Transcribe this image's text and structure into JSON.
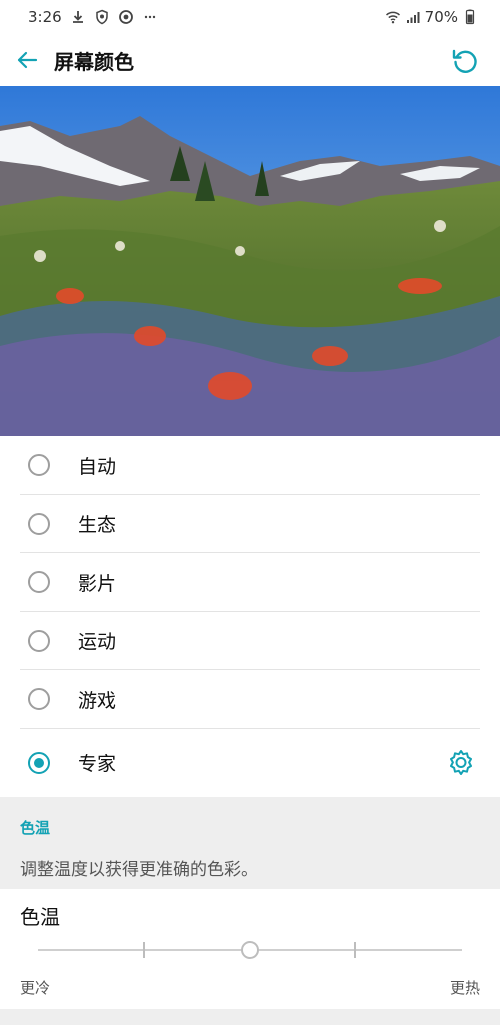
{
  "status_bar": {
    "time": "3:26",
    "battery": "70%",
    "icons": [
      "download-icon",
      "shield-badge-icon",
      "sync-icon",
      "more-dots-icon",
      "wifi-icon",
      "signal-icon",
      "battery-icon"
    ]
  },
  "app_bar": {
    "title": "屏幕颜色",
    "back_icon": "back-arrow-icon",
    "reset_icon": "reset-icon"
  },
  "preview": {
    "description_icon": "landscape-preview-image"
  },
  "options": [
    {
      "label": "自动",
      "selected": false
    },
    {
      "label": "生态",
      "selected": false
    },
    {
      "label": "影片",
      "selected": false
    },
    {
      "label": "运动",
      "selected": false
    },
    {
      "label": "游戏",
      "selected": false
    },
    {
      "label": "专家",
      "selected": true
    }
  ],
  "section": {
    "header": "色温",
    "description": "调整温度以获得更准确的色彩。"
  },
  "temperature": {
    "title": "色温",
    "min_label": "更冷",
    "max_label": "更热",
    "value": 0.5
  },
  "colors": {
    "accent": "#13a2b4",
    "section_bg": "#eeeeee"
  }
}
